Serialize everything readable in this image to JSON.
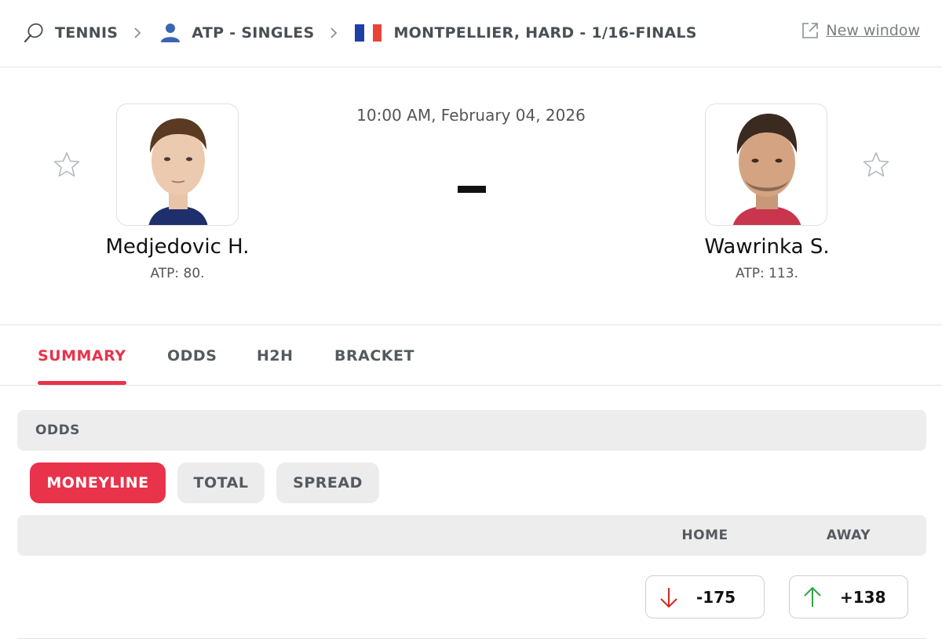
{
  "breadcrumb": {
    "sport": "TENNIS",
    "category": "ATP - SINGLES",
    "tournament": "MONTPELLIER, HARD - 1/16-FINALS",
    "new_window": "New window"
  },
  "match": {
    "datetime": "10:00 AM, February 04, 2026",
    "score": "-",
    "home": {
      "name": "Medjedovic H.",
      "rank": "ATP: 80."
    },
    "away": {
      "name": "Wawrinka S.",
      "rank": "ATP: 113."
    }
  },
  "tabs": [
    {
      "label": "SUMMARY",
      "active": true
    },
    {
      "label": "ODDS",
      "active": false
    },
    {
      "label": "H2H",
      "active": false
    },
    {
      "label": "BRACKET",
      "active": false
    }
  ],
  "odds": {
    "section_title": "ODDS",
    "market_buttons": [
      "MONEYLINE",
      "TOTAL",
      "SPREAD"
    ],
    "selected_market": "MONEYLINE",
    "columns": [
      "HOME",
      "AWAY"
    ],
    "values": [
      {
        "value": "-175",
        "trend": "down",
        "trend_color": "#d0281f"
      },
      {
        "value": "+138",
        "trend": "up",
        "trend_color": "#2ea344"
      }
    ]
  },
  "colors": {
    "accent": "#e8334b",
    "flag_france": [
      "#1f3fa8",
      "#ffffff",
      "#e8443a"
    ]
  },
  "icons": [
    "tennis-racket-icon",
    "chevron-right-icon",
    "person-icon",
    "france-flag-icon",
    "external-link-icon",
    "star-icon",
    "arrow-down-icon",
    "arrow-up-icon"
  ]
}
